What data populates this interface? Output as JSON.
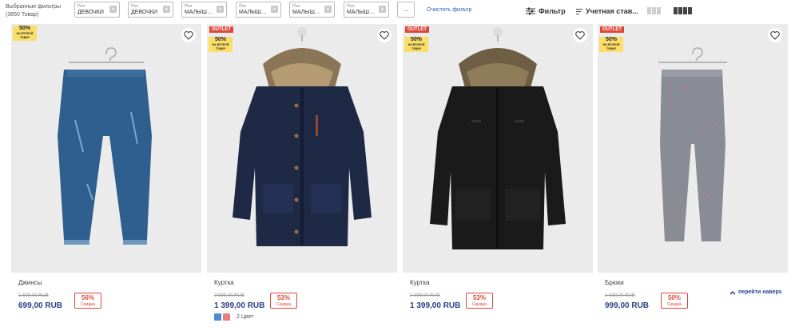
{
  "filters": {
    "selected_title": "Выбранные фильтры",
    "selected_count": "(3650 Товар)",
    "chips": [
      {
        "label": "Пол",
        "value": "ДЕВОЧКИ"
      },
      {
        "label": "Пол",
        "value": "ДЕВОЧКИ"
      },
      {
        "label": "Пол",
        "value": "МАЛЫШИ М..."
      },
      {
        "label": "Пол",
        "value": "МАЛЫШИ М..."
      },
      {
        "label": "Пол",
        "value": "МАЛЫШКИ ..."
      },
      {
        "label": "Пол",
        "value": "МАЛЫШКИ ..."
      }
    ],
    "more_label": "...",
    "clear_label": "Очистить фильтр",
    "filter_label": "Фильтр",
    "sort_label": "Учетная став...",
    "colors": {
      "accent": "#2b3f8a",
      "link": "#2b5fb4",
      "discount": "#e0473a",
      "promo": "#fbdd6a"
    }
  },
  "products": [
    {
      "name": "Джинсы",
      "old_price": "1 599,00 RUB",
      "price": "699,00 RUB",
      "discount": "56%",
      "discount_label": "Скидка",
      "badge": {
        "pct": "50%",
        "sub": "НА ВТОРОЙ ТОВАР"
      },
      "outlet": ""
    },
    {
      "name": "Куртка",
      "old_price": "2 999,00 RUB",
      "price": "1 399,00 RUB",
      "discount": "53%",
      "discount_label": "Скидка",
      "badge": {
        "pct": "50%",
        "sub": "НА ВТОРОЙ ТОВАР"
      },
      "outlet": "OUTLET",
      "colors_label": "2 Цвет"
    },
    {
      "name": "Куртка",
      "old_price": "2 999,00 RUB",
      "price": "1 399,00 RUB",
      "discount": "53%",
      "discount_label": "Скидка",
      "badge": {
        "pct": "50%",
        "sub": "НА ВТОРОЙ ТОВАР"
      },
      "outlet": "OUTLET"
    },
    {
      "name": "Брюки",
      "old_price": "1 999,00 RUB",
      "price": "999,00 RUB",
      "discount": "50%",
      "discount_label": "Скидка",
      "badge": {
        "pct": "50%",
        "sub": "НА ВТОРОЙ ТОВАР"
      },
      "outlet": "OUTLET"
    }
  ],
  "back_to_top": "перейти наверх"
}
